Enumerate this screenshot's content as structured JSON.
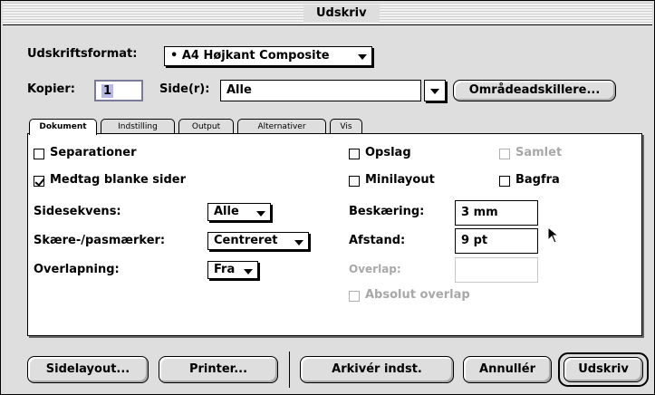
{
  "window": {
    "title": "Udskriv"
  },
  "format": {
    "label": "Udskriftsformat:",
    "value": "• A4 Højkant Composite"
  },
  "copies": {
    "label": "Kopier:",
    "value": "1"
  },
  "pages": {
    "label": "Side(r):",
    "value": "Alle"
  },
  "range_separators_button": "Områdeadskillere...",
  "tabs": [
    "Dokument",
    "Indstilling",
    "Output",
    "Alternativer",
    "Vis"
  ],
  "document": {
    "separations": "Separationer",
    "include_blank_pages": "Medtag blanke sider",
    "page_sequence": {
      "label": "Sidesekvens:",
      "value": "Alle"
    },
    "crop_marks": {
      "label": "Skære-/pasmærker:",
      "value": "Centreret"
    },
    "overlapping": {
      "label": "Overlapning:",
      "value": "Fra"
    },
    "spreads": "Opslag",
    "collated": "Samlet",
    "thumbnails": "Minilayout",
    "back_to_front": "Bagfra",
    "bleed": {
      "label": "Beskæring:",
      "value": "3  mm"
    },
    "offset": {
      "label": "Afstand:",
      "value": "9 pt"
    },
    "overlap": {
      "label": "Overlap:",
      "value": ""
    },
    "absolute_overlap": "Absolut overlap"
  },
  "buttons": {
    "page_setup": "Sidelayout...",
    "printer": "Printer...",
    "capture_settings": "Arkivér indst.",
    "cancel": "Annullér",
    "print": "Udskriv"
  }
}
